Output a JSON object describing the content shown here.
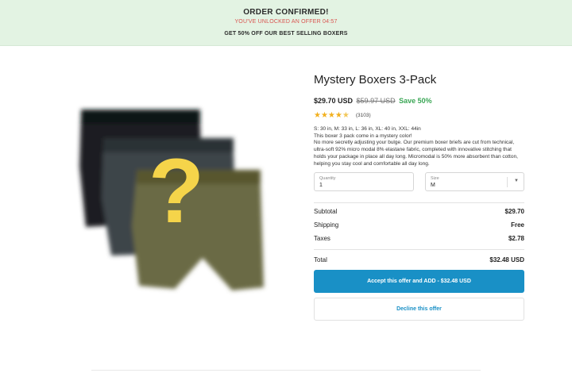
{
  "banner": {
    "title": "ORDER CONFIRMED!",
    "offer_text": "YOU'VE UNLOCKED AN OFFER 04:57",
    "subtitle": "GET 50% OFF OUR BEST SELLING BOXERS"
  },
  "product": {
    "title": "Mystery Boxers 3-Pack",
    "price": "$29.70 USD",
    "compare_price": "$59.97 USD",
    "save_label": "Save 50%",
    "rating": 4.5,
    "stars_full": "★★★★",
    "stars_half": "★",
    "review_count": "(3103)",
    "image_overlay": "?",
    "description": [
      "S: 30 in, M: 33 in, L: 36 in, XL: 40 in, XXL: 44in",
      "This boxer 3 pack come in a mystery color!",
      "No more secretly adjusting your bulge. Our premium boxer briefs are cut from technical, ultra-soft 92% micro modal 8% elastane fabric, completed with innovative stitching that holds your package in place all day long. Micromodal is 50% more absorbent than cotton, helping you stay cool and comfortable all day long."
    ]
  },
  "fields": {
    "quantity_label": "Quantity",
    "quantity_value": "1",
    "size_label": "Size",
    "size_value": "M",
    "size_chevron_icon": "chevron-down-icon"
  },
  "summary": {
    "subtotal_label": "Subtotal",
    "subtotal_value": "$29.70",
    "shipping_label": "Shipping",
    "shipping_value": "Free",
    "taxes_label": "Taxes",
    "taxes_value": "$2.78",
    "total_label": "Total",
    "total_value": "$32.48 USD"
  },
  "actions": {
    "accept_label": "Accept this offer and ADD - $32.48 USD",
    "decline_label": "Decline this offer"
  },
  "colors": {
    "banner_bg": "#e3f3e3",
    "offer_red": "#d9534f",
    "save_green": "#3aa655",
    "accent_blue": "#1990c6",
    "star_yellow": "#f2b01e",
    "question_yellow": "#f5d44a"
  }
}
